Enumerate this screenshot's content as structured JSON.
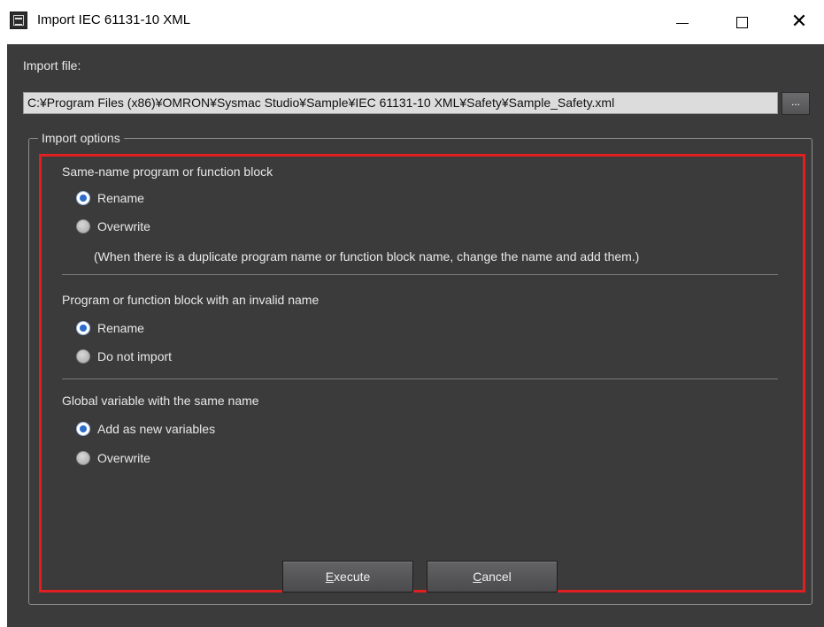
{
  "window": {
    "title": "Import IEC 61131-10 XML",
    "minimize_glyph": "—",
    "maximize_glyph": "☐",
    "close_glyph": "✕"
  },
  "import_file": {
    "label": "Import file:",
    "path": "C:¥Program Files (x86)¥OMRON¥Sysmac Studio¥Sample¥IEC 61131-10 XML¥Safety¥Sample_Safety.xml",
    "browse_label": "..."
  },
  "options": {
    "group_title": "Import options",
    "highlight_color": "#e02020",
    "sections": [
      {
        "title": "Same-name program or function block",
        "choices": [
          {
            "label": "Rename",
            "selected": true
          },
          {
            "label": "Overwrite",
            "selected": false
          }
        ],
        "note": "(When there is a duplicate program name or function block name, change the name and add them.)"
      },
      {
        "title": "Program or function block with an invalid name",
        "choices": [
          {
            "label": "Rename",
            "selected": true
          },
          {
            "label": "Do not import",
            "selected": false
          }
        ]
      },
      {
        "title": "Global variable with the same name",
        "choices": [
          {
            "label": "Add as new variables",
            "selected": true
          },
          {
            "label": "Overwrite",
            "selected": false
          }
        ]
      }
    ]
  },
  "buttons": {
    "execute_accel": "E",
    "execute_rest": "xecute",
    "cancel_accel": "C",
    "cancel_rest": "ancel"
  },
  "colors": {
    "client_bg": "#3b3b3c",
    "radio_selected": "#2d6cc8"
  }
}
